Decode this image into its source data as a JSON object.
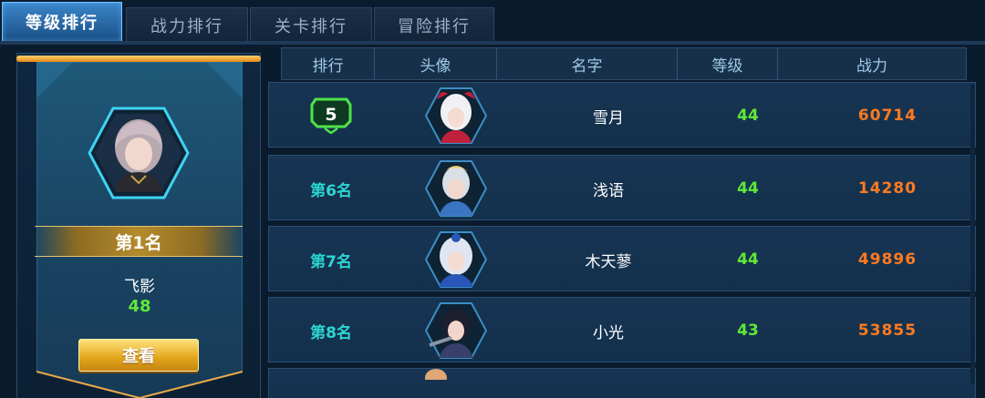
{
  "tabs": [
    {
      "label": "等级排行",
      "active": true
    },
    {
      "label": "战力排行",
      "active": false
    },
    {
      "label": "关卡排行",
      "active": false
    },
    {
      "label": "冒险排行",
      "active": false
    }
  ],
  "top_player": {
    "rank_label": "第1名",
    "name": "飞影",
    "level": "48",
    "view_button": "查看"
  },
  "table": {
    "headers": [
      "排行",
      "头像",
      "名字",
      "等级",
      "战力"
    ],
    "rows": [
      {
        "rank": "5",
        "rank_is_badge": true,
        "name": "雪月",
        "level": "44",
        "power": "60714",
        "avatar_hair": "#f1f1f4",
        "avatar_accent": "#c0203a"
      },
      {
        "rank": "第6名",
        "rank_is_badge": false,
        "name": "浅语",
        "level": "44",
        "power": "14280",
        "avatar_hair": "#d9dfe6",
        "avatar_accent": "#3c74c4"
      },
      {
        "rank": "第7名",
        "rank_is_badge": false,
        "name": "木天蓼",
        "level": "44",
        "power": "49896",
        "avatar_hair": "#dfe6f2",
        "avatar_accent": "#2a56b8"
      },
      {
        "rank": "第8名",
        "rank_is_badge": false,
        "name": "小光",
        "level": "43",
        "power": "53855",
        "avatar_hair": "#1d1f2e",
        "avatar_accent": "#36406a"
      }
    ]
  },
  "colors": {
    "level_green": "#5fe83a",
    "power_orange": "#ff7a1f",
    "rank_cyan": "#2dd6d0",
    "gold": "#e2a41b"
  }
}
